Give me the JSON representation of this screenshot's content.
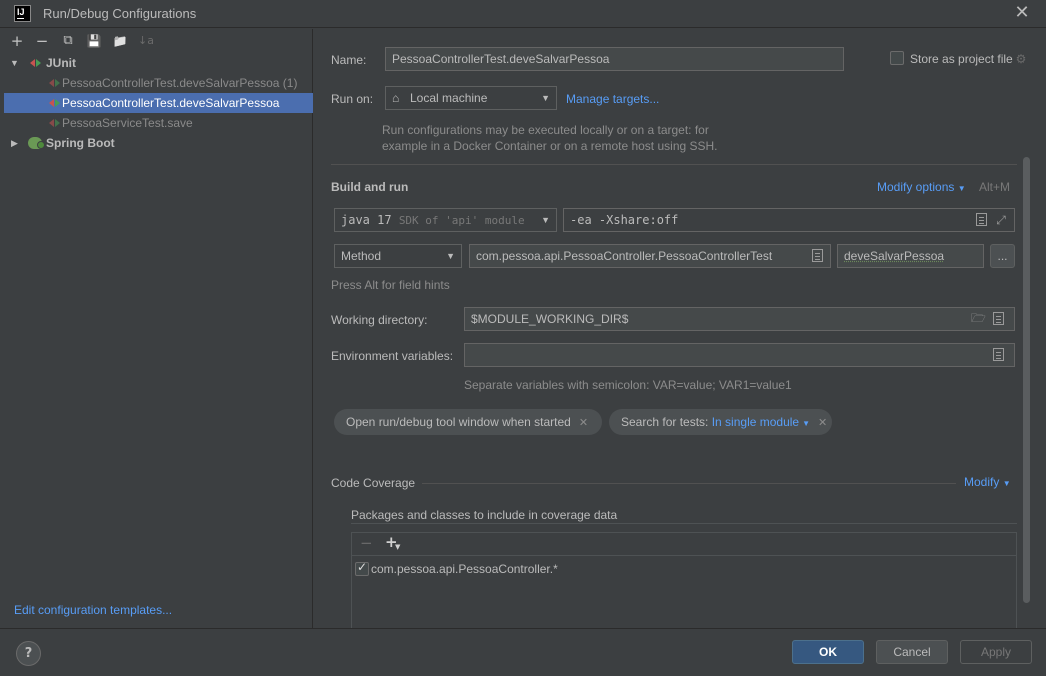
{
  "window": {
    "title": "Run/Debug Configurations",
    "logo_text": "IJ"
  },
  "toolbar": {
    "add": "+",
    "remove": "−",
    "copy": "⧉",
    "save": "💾",
    "folder": "📁",
    "sort": "↓a"
  },
  "tree": {
    "junit": {
      "label": "JUnit",
      "expanded": true
    },
    "items": [
      {
        "label": "PessoaControllerTest.deveSalvarPessoa (1)",
        "faded": true
      },
      {
        "label": "PessoaControllerTest.deveSalvarPessoa",
        "selected": true
      },
      {
        "label": "PessoaServiceTest.save",
        "faded": true
      }
    ],
    "spring_boot": {
      "label": "Spring Boot",
      "expanded": false
    }
  },
  "edit_templates_label": "Edit configuration templates...",
  "form": {
    "name_label": "Name:",
    "name_value": "PessoaControllerTest.deveSalvarPessoa",
    "store_label": "Store as project file",
    "store_checked": false,
    "run_on_label": "Run on:",
    "run_on_value": "Local machine",
    "manage_targets_label": "Manage targets...",
    "run_on_hint_1": "Run configurations may be executed locally or on a target: for",
    "run_on_hint_2": "example in a Docker Container or on a remote host using SSH.",
    "build_run_title": "Build and run",
    "modify_options_label": "Modify options",
    "modify_options_shortcut": "Alt+M",
    "jdk_value": "java 17",
    "jdk_hint": "SDK of 'api' module",
    "vm_options_value": "-ea -Xshare:off",
    "test_kind_value": "Method",
    "class_value": "com.pessoa.api.PessoaController.PessoaControllerTest",
    "method_value": "deveSalvarPessoa",
    "browse_label": "...",
    "field_hints": "Press Alt for field hints",
    "workdir_label": "Working directory:",
    "workdir_value": "$MODULE_WORKING_DIR$",
    "env_label": "Environment variables:",
    "env_value": "",
    "env_hint": "Separate variables with semicolon: VAR=value; VAR1=value1",
    "chip_open_tool": "Open run/debug tool window when started",
    "chip_search_label": "Search for tests:",
    "chip_search_value": "In single module",
    "code_coverage_title": "Code Coverage",
    "modify_label": "Modify",
    "packages_label": "Packages and classes to include in coverage data",
    "coverage_items": [
      {
        "label": "com.pessoa.api.PessoaController.*",
        "checked": true
      }
    ]
  },
  "buttons": {
    "help": "?",
    "ok": "OK",
    "cancel": "Cancel",
    "apply": "Apply"
  }
}
